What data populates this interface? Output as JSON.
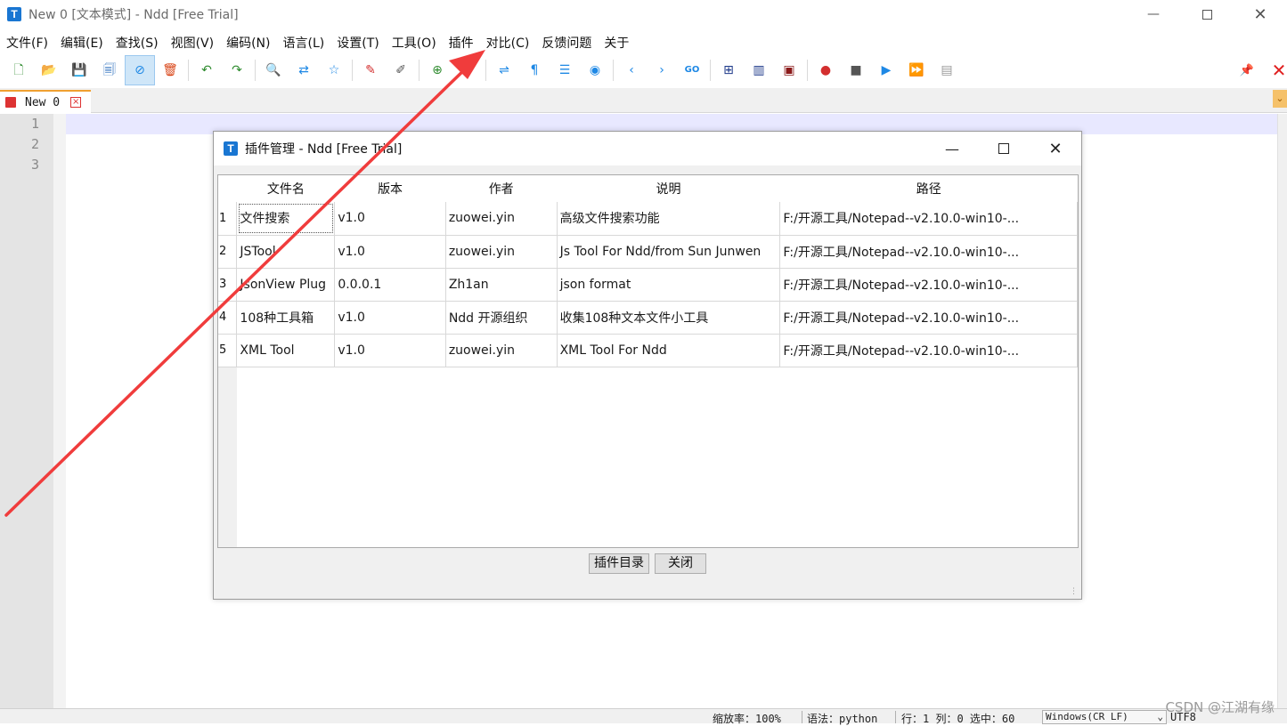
{
  "window": {
    "title": "New 0 [文本模式] - Ndd [Free Trial]",
    "icon_letter": "T"
  },
  "menu": [
    "文件(F)",
    "编辑(E)",
    "查找(S)",
    "视图(V)",
    "编码(N)",
    "语言(L)",
    "设置(T)",
    "工具(O)",
    "插件",
    "对比(C)",
    "反馈问题",
    "关于"
  ],
  "toolbar_icons": [
    {
      "name": "new-file-icon",
      "glyph": "🗋",
      "color": "#2e8b2e"
    },
    {
      "name": "open-file-icon",
      "glyph": "📂",
      "color": "#e6a21a"
    },
    {
      "name": "save-icon",
      "glyph": "💾",
      "color": "#2c6fbf"
    },
    {
      "name": "save-all-icon",
      "glyph": "🗐",
      "color": "#2c6fbf"
    },
    {
      "name": "readonly-icon",
      "glyph": "⊘",
      "color": "#1e88e5"
    },
    {
      "name": "close-file-icon",
      "glyph": "🗑",
      "color": "#d84315"
    },
    {
      "name": "undo-icon",
      "glyph": "↶",
      "color": "#2e8b2e"
    },
    {
      "name": "redo-icon",
      "glyph": "↷",
      "color": "#2e8b2e"
    },
    {
      "name": "find-icon",
      "glyph": "🔍",
      "color": "#333333"
    },
    {
      "name": "replace-icon",
      "glyph": "⇄",
      "color": "#1e88e5"
    },
    {
      "name": "bookmark-icon",
      "glyph": "☆",
      "color": "#1e88e5"
    },
    {
      "name": "mark-icon",
      "glyph": "✎",
      "color": "#d32f2f"
    },
    {
      "name": "clear-mark-icon",
      "glyph": "✐",
      "color": "#555555"
    },
    {
      "name": "zoom-in-icon",
      "glyph": "⊕",
      "color": "#2e8b2e"
    },
    {
      "name": "zoom-out-icon",
      "glyph": "⊖",
      "color": "#d32f2f"
    },
    {
      "name": "wrap-icon",
      "glyph": "⇌",
      "color": "#1e88e5"
    },
    {
      "name": "show-symbols-icon",
      "glyph": "¶",
      "color": "#1e88e5"
    },
    {
      "name": "indent-guide-icon",
      "glyph": "☰",
      "color": "#1e88e5"
    },
    {
      "name": "target-icon",
      "glyph": "◉",
      "color": "#1e88e5"
    },
    {
      "name": "prev-icon",
      "glyph": "‹",
      "color": "#1e88e5"
    },
    {
      "name": "next-icon",
      "glyph": "›",
      "color": "#1e88e5"
    },
    {
      "name": "goto-icon",
      "glyph": "GO",
      "color": "#1e88e5"
    },
    {
      "name": "compare-icon",
      "glyph": "⊞",
      "color": "#1e3a8a"
    },
    {
      "name": "split-icon",
      "glyph": "▥",
      "color": "#1e3a8a"
    },
    {
      "name": "monitor-icon",
      "glyph": "▣",
      "color": "#8b1a1a"
    },
    {
      "name": "record-icon",
      "glyph": "●",
      "color": "#d32f2f"
    },
    {
      "name": "stop-icon",
      "glyph": "■",
      "color": "#555555"
    },
    {
      "name": "play-icon",
      "glyph": "▶",
      "color": "#1e88e5"
    },
    {
      "name": "play-multi-icon",
      "glyph": "⏩",
      "color": "#1e88e5"
    },
    {
      "name": "save-macro-icon",
      "glyph": "▤",
      "color": "#999999"
    }
  ],
  "toolbar_right": {
    "pin_glyph": "📌",
    "close_glyph": "✕"
  },
  "tab": {
    "label": "New 0"
  },
  "editor": {
    "line_numbers": [
      "1",
      "2",
      "3"
    ]
  },
  "status": {
    "zoom": "缩放率：100%",
    "syntax": "语法：python",
    "position": "行：1  列：0  选中：60",
    "eol": "Windows(CR LF)",
    "encoding": "UTF8"
  },
  "watermark": "CSDN @江湖有缘",
  "dialog": {
    "title": "插件管理 - Ndd [Free Trial]",
    "columns": [
      "文件名",
      "版本",
      "作者",
      "说明",
      "路径"
    ],
    "rows": [
      {
        "n": "1",
        "file": "文件搜索",
        "version": "v1.0",
        "author": "zuowei.yin",
        "desc": "高级文件搜索功能",
        "path": "F:/开源工具/Notepad--v2.10.0-win10-..."
      },
      {
        "n": "2",
        "file": "JSTool",
        "version": "v1.0",
        "author": "zuowei.yin",
        "desc": "Js Tool For Ndd/from Sun Junwen",
        "path": "F:/开源工具/Notepad--v2.10.0-win10-..."
      },
      {
        "n": "3",
        "file": "JsonView Plug",
        "version": "0.0.0.1",
        "author": "Zh1an",
        "desc": "json format",
        "path": "F:/开源工具/Notepad--v2.10.0-win10-..."
      },
      {
        "n": "4",
        "file": "108种工具箱",
        "version": "v1.0",
        "author": "Ndd 开源组织",
        "desc": "收集108种文本文件小工具",
        "path": "F:/开源工具/Notepad--v2.10.0-win10-..."
      },
      {
        "n": "5",
        "file": "XML Tool",
        "version": "v1.0",
        "author": "zuowei.yin",
        "desc": "XML Tool For Ndd",
        "path": "F:/开源工具/Notepad--v2.10.0-win10-..."
      }
    ],
    "btn_plugin_dir": "插件目录",
    "btn_close": "关闭"
  },
  "annotation": {
    "arrow_color": "#f03c3c"
  }
}
